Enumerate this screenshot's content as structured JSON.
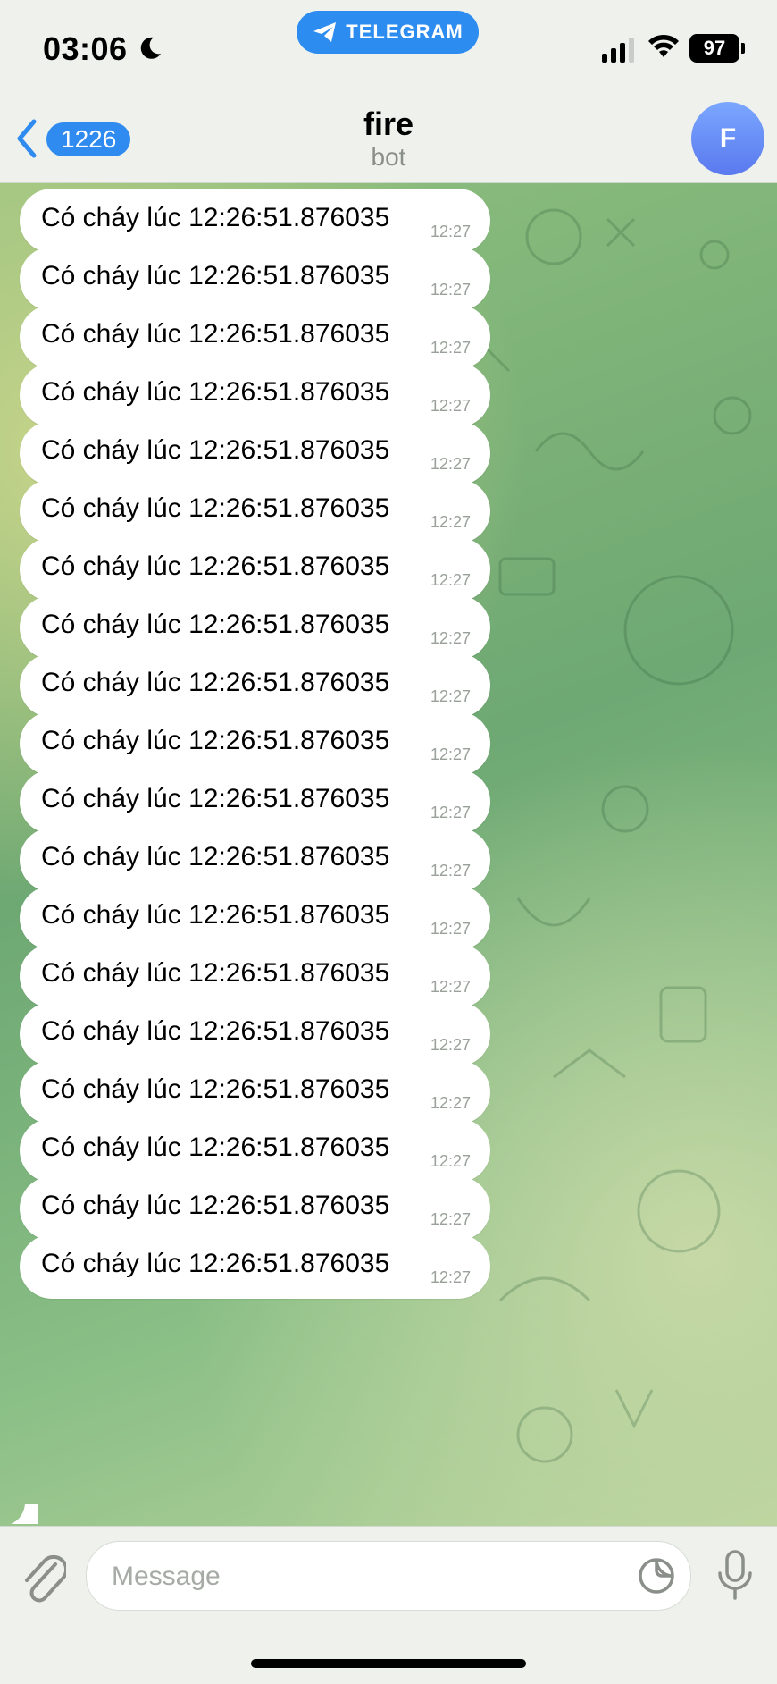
{
  "status_bar": {
    "time": "03:06",
    "telegram_label": "TELEGRAM",
    "battery": "97"
  },
  "header": {
    "back_count": "1226",
    "title": "fire",
    "subtitle": "bot",
    "avatar_letter": "F"
  },
  "messages": [
    {
      "text": "Có cháy lúc 12:26:51.876035",
      "time": "12:27"
    },
    {
      "text": "Có cháy lúc 12:26:51.876035",
      "time": "12:27"
    },
    {
      "text": "Có cháy lúc 12:26:51.876035",
      "time": "12:27"
    },
    {
      "text": "Có cháy lúc 12:26:51.876035",
      "time": "12:27"
    },
    {
      "text": "Có cháy lúc 12:26:51.876035",
      "time": "12:27"
    },
    {
      "text": "Có cháy lúc 12:26:51.876035",
      "time": "12:27"
    },
    {
      "text": "Có cháy lúc 12:26:51.876035",
      "time": "12:27"
    },
    {
      "text": "Có cháy lúc 12:26:51.876035",
      "time": "12:27"
    },
    {
      "text": "Có cháy lúc 12:26:51.876035",
      "time": "12:27"
    },
    {
      "text": "Có cháy lúc 12:26:51.876035",
      "time": "12:27"
    },
    {
      "text": "Có cháy lúc 12:26:51.876035",
      "time": "12:27"
    },
    {
      "text": "Có cháy lúc 12:26:51.876035",
      "time": "12:27"
    },
    {
      "text": "Có cháy lúc 12:26:51.876035",
      "time": "12:27"
    },
    {
      "text": "Có cháy lúc 12:26:51.876035",
      "time": "12:27"
    },
    {
      "text": "Có cháy lúc 12:26:51.876035",
      "time": "12:27"
    },
    {
      "text": "Có cháy lúc 12:26:51.876035",
      "time": "12:27"
    },
    {
      "text": "Có cháy lúc 12:26:51.876035",
      "time": "12:27"
    },
    {
      "text": "Có cháy lúc 12:26:51.876035",
      "time": "12:27"
    },
    {
      "text": "Có cháy lúc 12:26:51.876035",
      "time": "12:27"
    }
  ],
  "composer": {
    "placeholder": "Message"
  },
  "icons": [
    "moon-icon",
    "telegram-icon",
    "signal-icon",
    "wifi-icon",
    "battery-icon",
    "chevron-left-icon",
    "paperclip-icon",
    "sticker-icon",
    "microphone-icon"
  ],
  "colors": {
    "accent": "#2f8bef",
    "bubble": "#ffffff",
    "timestamp": "#9aa09a",
    "wallpaper": "#7bb27a"
  }
}
